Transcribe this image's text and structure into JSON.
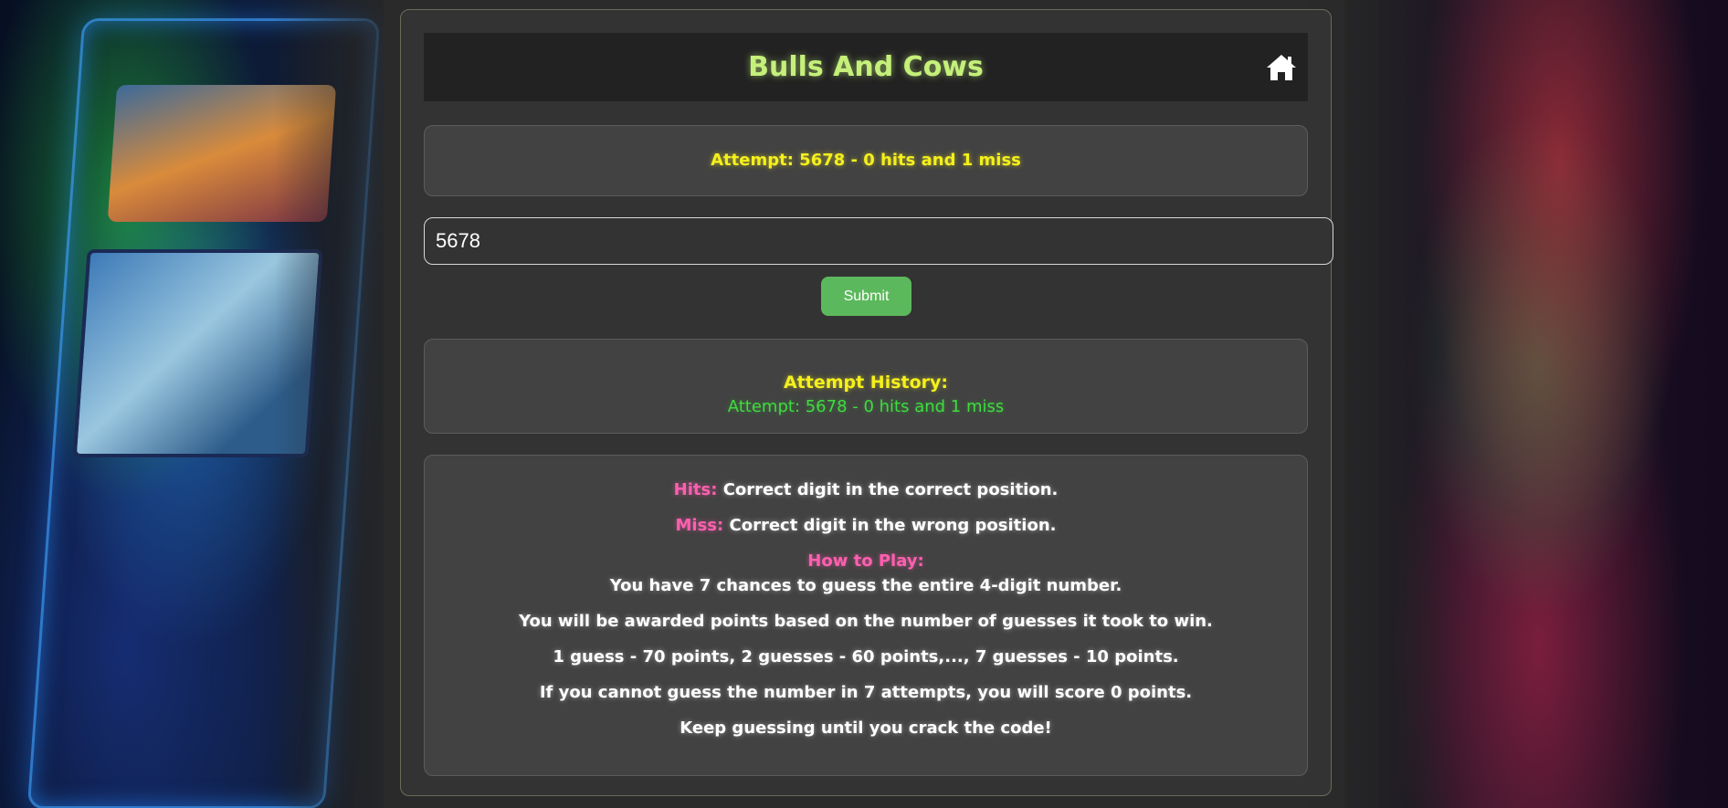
{
  "header": {
    "title": "Bulls And Cows",
    "home_icon": "home-icon"
  },
  "status": {
    "text": "Attempt: 5678 - 0 hits and 1 miss"
  },
  "guess": {
    "value": "5678"
  },
  "submit": {
    "label": "Submit"
  },
  "history": {
    "title": "Attempt History:",
    "items": [
      "Attempt: 5678 - 0 hits and 1 miss"
    ]
  },
  "rules": {
    "hits_label": "Hits:",
    "hits_text": "Correct digit in the correct position.",
    "miss_label": "Miss:",
    "miss_text": "Correct digit in the wrong position.",
    "how_to_play": "How to Play:",
    "lines": [
      "You have 7 chances to guess the entire 4-digit number.",
      "You will be awarded points based on the number of guesses it took to win.",
      "1 guess - 70 points, 2 guesses - 60 points,..., 7 guesses - 10 points.",
      "If you cannot guess the number in 7 attempts, you will score 0 points.",
      "Keep guessing until you crack the code!"
    ]
  },
  "colors": {
    "title": "#c5f07a",
    "status": "#f5f01c",
    "history_item": "#3fdc3f",
    "accent_pink": "#ff5fb0",
    "submit_bg": "#5cb85c"
  }
}
